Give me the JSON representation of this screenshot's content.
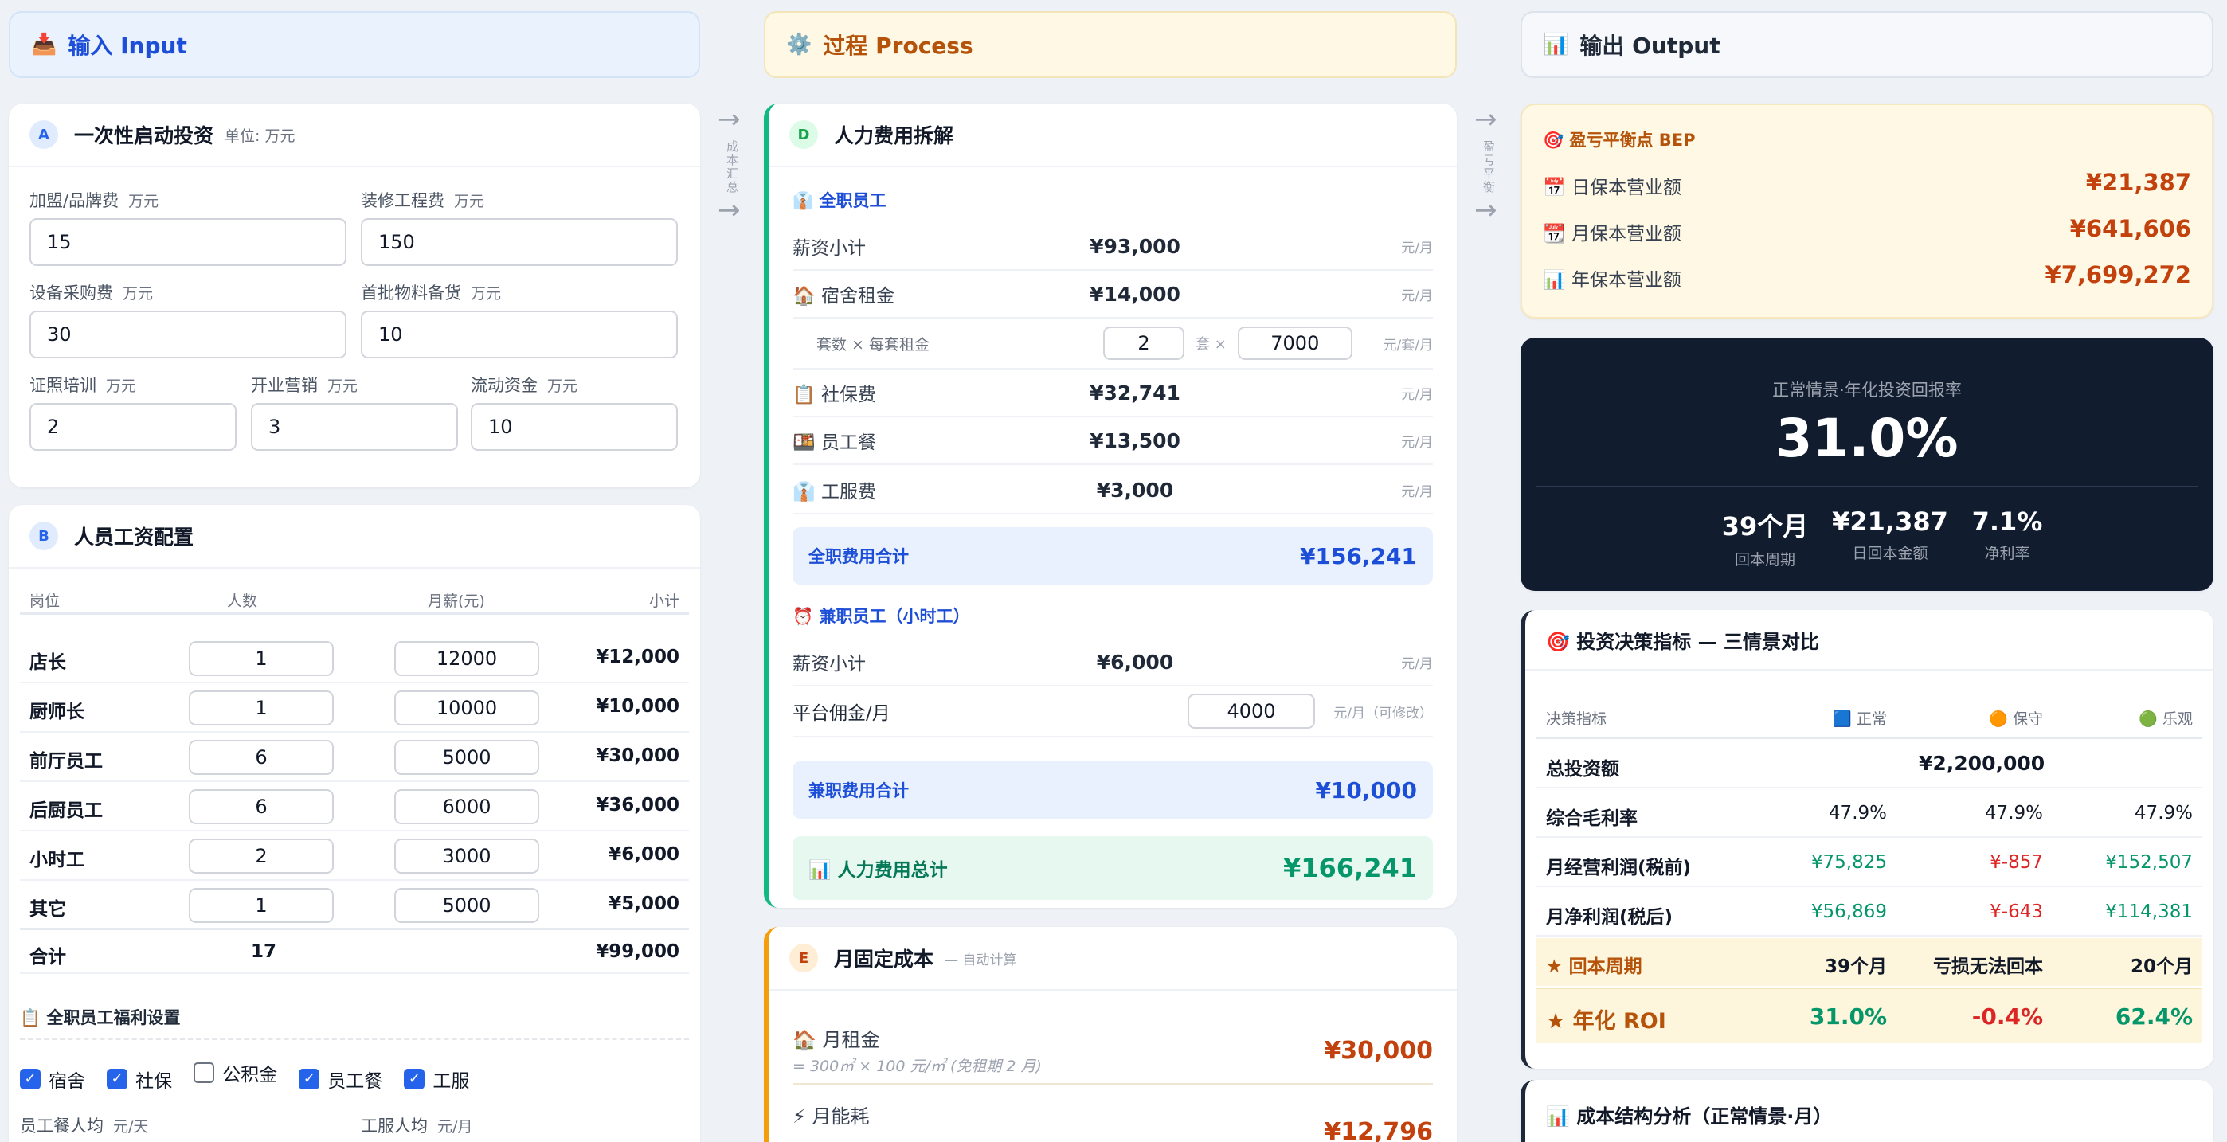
{
  "columns": {
    "input": {
      "icon": "📥",
      "title": "输入 Input"
    },
    "process": {
      "icon": "⚙️",
      "title": "过程 Process"
    },
    "output": {
      "icon": "📊",
      "title": "输出 Output"
    }
  },
  "arrows": {
    "left_label": "成本汇总",
    "right_label": "盈亏平衡"
  },
  "card_a": {
    "badge": "A",
    "title": "一次性启动投资",
    "unit": "单位: 万元",
    "fields": [
      {
        "label": "加盟/品牌费",
        "unit": "万元",
        "value": "15"
      },
      {
        "label": "装修工程费",
        "unit": "万元",
        "value": "150"
      },
      {
        "label": "设备采购费",
        "unit": "万元",
        "value": "30"
      },
      {
        "label": "首批物料备货",
        "unit": "万元",
        "value": "10"
      },
      {
        "label": "证照培训",
        "unit": "万元",
        "value": "2"
      },
      {
        "label": "开业营销",
        "unit": "万元",
        "value": "3"
      },
      {
        "label": "流动资金",
        "unit": "万元",
        "value": "10"
      }
    ]
  },
  "card_b": {
    "badge": "B",
    "title": "人员工资配置",
    "headers": [
      "岗位",
      "人数",
      "月薪(元)",
      "小计"
    ],
    "rows": [
      {
        "role": "店长",
        "count": "1",
        "salary": "12000",
        "subtotal": "¥12,000"
      },
      {
        "role": "厨师长",
        "count": "1",
        "salary": "10000",
        "subtotal": "¥10,000"
      },
      {
        "role": "前厅员工",
        "count": "6",
        "salary": "5000",
        "subtotal": "¥30,000"
      },
      {
        "role": "后厨员工",
        "count": "6",
        "salary": "6000",
        "subtotal": "¥36,000"
      },
      {
        "role": "小时工",
        "count": "2",
        "salary": "3000",
        "subtotal": "¥6,000"
      },
      {
        "role": "其它",
        "count": "1",
        "salary": "5000",
        "subtotal": "¥5,000"
      }
    ],
    "total": {
      "label": "合计",
      "count": "17",
      "subtotal": "¥99,000"
    },
    "welfare_title": "📋 全职员工福利设置",
    "welfare": [
      {
        "label": "宿舍",
        "checked": true
      },
      {
        "label": "社保",
        "checked": true
      },
      {
        "label": "公积金",
        "checked": false
      },
      {
        "label": "员工餐",
        "checked": true
      },
      {
        "label": "工服",
        "checked": true
      }
    ],
    "meal_label": "员工餐人均",
    "meal_unit": "元/天",
    "uniform_label": "工服人均",
    "uniform_unit": "元/月"
  },
  "card_d": {
    "badge": "D",
    "title": "人力费用拆解",
    "fulltime_title": "👔 全职员工",
    "rows": [
      {
        "name": "薪资小计",
        "value": "¥93,000",
        "unit": "元/月"
      },
      {
        "name": "🏠 宿舍租金",
        "value": "¥14,000",
        "unit": "元/月"
      },
      {
        "name": "📋 社保费",
        "value": "¥32,741",
        "unit": "元/月"
      },
      {
        "name": "🍱 员工餐",
        "value": "¥13,500",
        "unit": "元/月"
      },
      {
        "name": "👔 工服费",
        "value": "¥3,000",
        "unit": "元/月"
      }
    ],
    "dorm_detail": {
      "label": "套数 × 每套租金",
      "sets": "2",
      "sets_unit": "套 ×",
      "rent": "7000",
      "rent_unit": "元/套/月"
    },
    "fulltime_total_label": "全职费用合计",
    "fulltime_total": "¥156,241",
    "parttime_title": "⏰ 兼职员工（小时工）",
    "pt_salary_name": "薪资小计",
    "pt_salary": "¥6,000",
    "pt_salary_unit": "元/月",
    "pt_platform_name": "平台佣金/月",
    "pt_platform_value": "4000",
    "pt_platform_unit": "元/月（可修改）",
    "parttime_total_label": "兼职费用合计",
    "parttime_total": "¥10,000",
    "grand_total_label": "📊 人力费用总计",
    "grand_total": "¥166,241"
  },
  "card_e": {
    "badge": "E",
    "title": "月固定成本",
    "subtitle": "— 自动计算",
    "rent_name": "🏠 月租金",
    "rent_formula": "= 300㎡ × 100 元/㎡ (免租期 2 月)",
    "rent_value": "¥30,000",
    "energy_name": "⚡ 月能耗",
    "energy_value": "¥12,796"
  },
  "bep": {
    "title": "🎯 盈亏平衡点 BEP",
    "rows": [
      {
        "label": "📅 日保本营业额",
        "value": "¥21,387"
      },
      {
        "label": "📆 月保本营业额",
        "value": "¥641,606"
      },
      {
        "label": "📊 年保本营业额",
        "value": "¥7,699,272"
      }
    ]
  },
  "roi": {
    "caption": "正常情景·年化投资回报率",
    "value": "31.0%",
    "stats": [
      {
        "value": "39个月",
        "label": "回本周期"
      },
      {
        "value": "¥21,387",
        "label": "日回本金额"
      },
      {
        "value": "7.1%",
        "label": "净利率"
      }
    ]
  },
  "decision": {
    "title": "🎯 投资决策指标 — 三情景对比",
    "headers": [
      "决策指标",
      "🟦 正常",
      "🟠 保守",
      "🟢 乐观"
    ],
    "rows": [
      {
        "name": "总投资额",
        "merged": "¥2,200,000"
      },
      {
        "name": "综合毛利率",
        "normal": "47.9%",
        "conservative": "47.9%",
        "optimistic": "47.9%"
      },
      {
        "name": "月经营利润(税前)",
        "normal": "¥75,825",
        "conservative": "¥-857",
        "optimistic": "¥152,507"
      },
      {
        "name": "月净利润(税后)",
        "normal": "¥56,869",
        "conservative": "¥-643",
        "optimistic": "¥114,381"
      }
    ],
    "payback": {
      "name": "★ 回本周期",
      "normal": "39个月",
      "conservative": "亏损无法回本",
      "optimistic": "20个月"
    },
    "roi_row": {
      "name": "★ 年化 ROI",
      "normal": "31.0%",
      "conservative": "-0.4%",
      "optimistic": "62.4%"
    }
  },
  "cost_structure": {
    "title": "📊 成本结构分析（正常情景·月）"
  },
  "colors": {
    "accent_blue": "#2563eb",
    "accent_orange": "#c2410c",
    "accent_green": "#059669",
    "negative_red": "#dc2626",
    "dark_card": "#111c2f"
  }
}
